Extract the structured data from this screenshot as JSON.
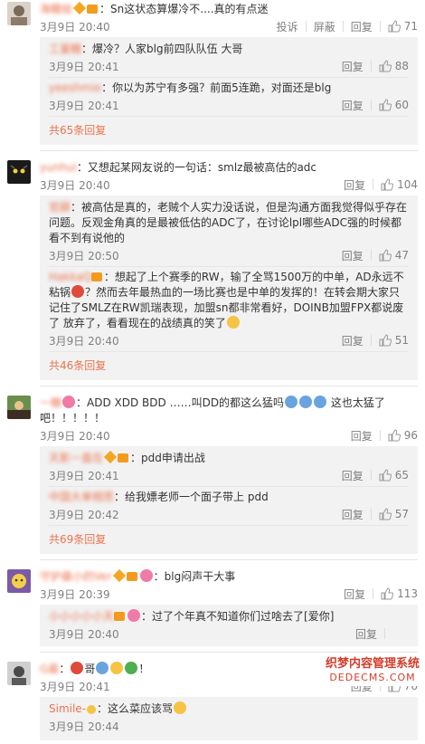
{
  "comments": [
    {
      "nick": "海糖",
      "nick_tail": "绘",
      "text": "Sn这状态算爆冷不....真的有点迷",
      "time": "3月9日 20:40",
      "actions": {
        "report": "投诉",
        "block": "屏蔽",
        "reply": "回复",
        "likes": "71"
      },
      "replies": [
        {
          "nick": "工量糖",
          "text": "爆冷？人家blg前四队队伍 大哥",
          "time": "3月9日 20:41",
          "reply": "回复",
          "likes": "88"
        },
        {
          "nick": "yeeshmie",
          "text": "你以为苏宁有多强？前面5连跪，对面还是blg",
          "time": "3月9日 20:41",
          "reply": "回复",
          "likes": "60"
        }
      ],
      "more": "共65条回复"
    },
    {
      "nick": "yunhui",
      "text": "又想起某网友说的一句话：smlz最被高估的adc",
      "time": "3月9日 20:40",
      "actions": {
        "reply": "回复",
        "likes": "104"
      },
      "replies": [
        {
          "nick": "官薛",
          "text": "被高估是真的，老贼个人实力没话说，但是沟通方面我觉得似乎存在问题。反观金角真的是最被低估的ADC了，在讨论lpl哪些ADC强的时候都看不到有说他的",
          "time": "3月9日 20:50",
          "reply": "回复",
          "likes": "47"
        },
        {
          "nick": "HakkaQ",
          "text": "想起了上个赛季的RW，输了全骂1500万的中单，AD永远不粘锅",
          "text2": "？然而去年最热血的一场比赛也是中单的发挥的！在转会期大家只记住了SMLZ在RW凯瑞表现，加盟sn都非常看好，DOINB加盟FPX都说废了 放弃了，看看现在的战绩真的笑了",
          "time": "3月9日 20:40",
          "reply": "回复",
          "likes": "51"
        }
      ],
      "more": "共46条回复"
    },
    {
      "nick": "一糖",
      "text": "ADD XDD BDD ……叫DD的都这么猛吗",
      "text2": "这也太猛了吧！！！！！",
      "time": "3月9日 20:40",
      "actions": {
        "reply": "回复",
        "likes": "96"
      },
      "replies": [
        {
          "nick": "天影一直在",
          "text": "pdd申请出战",
          "time": "3月9日 20:41",
          "reply": "回复",
          "likes": "65"
        },
        {
          "nick": "中国大单相思",
          "text": "给我嫖老师一个面子带上 pdd",
          "time": "3月9日 20:42",
          "reply": "回复",
          "likes": "57"
        }
      ],
      "more": "共69条回复"
    },
    {
      "nick": "守护最小的Ver",
      "text": "blg闷声干大事",
      "time": "3月9日 20:39",
      "actions": {
        "reply": "回复",
        "likes": "113"
      },
      "replies": [
        {
          "nick": "小小小小小天",
          "text": "过了个年真不知道你们过啥去了[爱你]",
          "time": "3月9日 20:40",
          "reply": "回复",
          "likes": ""
        }
      ],
      "more": ""
    },
    {
      "nick": "G酱",
      "text": "哥",
      "text_tail": "！",
      "time": "3月9日 20:41",
      "actions": {
        "reply": "回复",
        "likes": "76"
      },
      "replies": [
        {
          "nick": "Simile-",
          "text": "这么菜应该骂",
          "time": "3月9日 20:44",
          "reply": "",
          "likes": ""
        }
      ],
      "more": ""
    }
  ],
  "watermark": {
    "line1": "织梦内容管理系统",
    "line2": "DEDECMS.COM"
  },
  "colors": {
    "link": "#eb7350",
    "meta": "#808080",
    "reply_bg": "#f2f2f2"
  }
}
